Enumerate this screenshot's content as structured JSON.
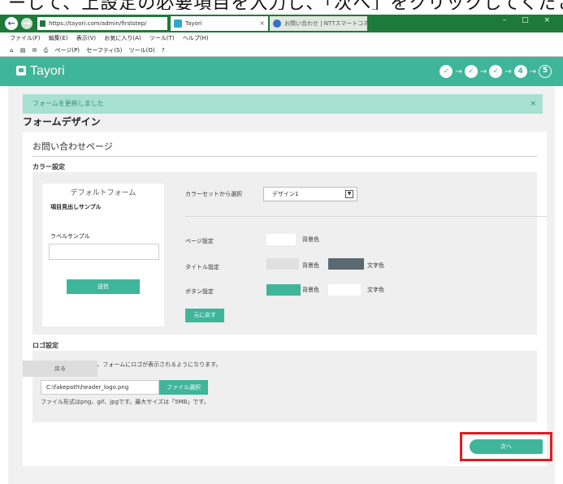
{
  "caption": "ーして、上設定の必要項目を入力し、「次へ」をクリックしてください",
  "browser": {
    "url": "https://tayori.com/admin/firststep/",
    "tabs": [
      {
        "title": "Tayori",
        "active": true
      },
      {
        "title": "お問い合わせ | NTTスマートコネクト",
        "active": false
      }
    ],
    "menu": [
      "ファイル(F)",
      "編集(E)",
      "表示(V)",
      "お気に入り(A)",
      "ツール(T)",
      "ヘルプ(H)"
    ],
    "toolbar": [
      "ページ(P)",
      "セーフティ(S)",
      "ツール(O)"
    ],
    "window_controls": "– □ ×"
  },
  "app": {
    "brand": "Tayori",
    "steps": [
      {
        "label": "✓",
        "done": true
      },
      {
        "label": "✓",
        "done": true
      },
      {
        "label": "✓",
        "done": true
      },
      {
        "label": "4",
        "done": true
      },
      {
        "label": "5",
        "done": false
      }
    ]
  },
  "notice": {
    "text": "フォームを更新しました",
    "close": "×"
  },
  "page_title": "フォームデザイン",
  "section_title": "お問い合わせページ",
  "color": {
    "heading": "カラー設定",
    "preview": {
      "title": "デフォルトフォーム",
      "item_heading": "項目見出しサンプル",
      "label_sample": "ラベルサンプル",
      "send_button": "送信"
    },
    "colorset_label": "カラーセットから選択",
    "colorset_value": "デザイン1",
    "page_label": "ページ設定",
    "page_bg": "背景色",
    "title_label": "タイトル設定",
    "title_bg": "背景色",
    "title_text": "文字色",
    "button_label": "ボタン設定",
    "button_bg": "背景色",
    "button_text": "文字色",
    "reset_button": "元に戻す",
    "colors": {
      "page_bg": "#ffffff",
      "title_bg": "#e0e0e0",
      "title_text": "#5a6a70",
      "button_bg": "#3fb59a",
      "button_text": "#ffffff"
    }
  },
  "logo": {
    "heading": "ロゴ設定",
    "description": "ロゴを設定しておくと、フォームにロゴが表示されるようになります。",
    "file_value": "C:\\fakepath\\header_logo.png",
    "file_button": "ファイル選択",
    "note": "ファイル形式はpng、gif、jpgです。最大サイズは「5MB」です。"
  },
  "footer": {
    "back": "戻る",
    "next": "次へ"
  },
  "accent": "#3fb59a",
  "highlight": "#e11b22"
}
